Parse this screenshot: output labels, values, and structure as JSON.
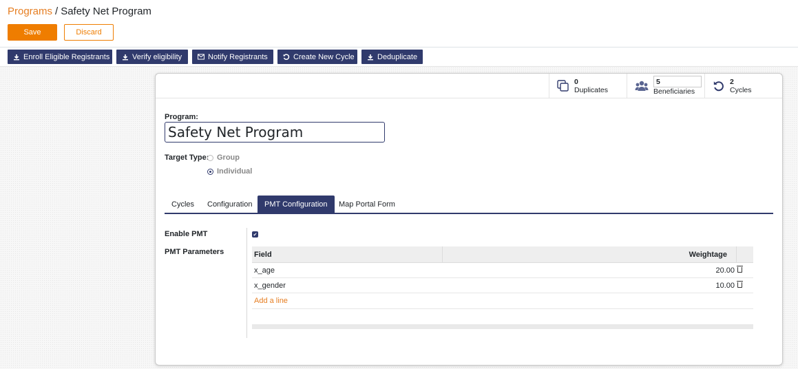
{
  "breadcrumb": {
    "parent": "Programs",
    "separator": "/",
    "current": "Safety Net Program"
  },
  "actions": {
    "save": "Save",
    "discard": "Discard"
  },
  "statusbar": {
    "buttons": [
      {
        "label": "Enroll Eligible Registrants",
        "icon": "download-icon"
      },
      {
        "label": "Verify eligibility",
        "icon": "download-icon"
      },
      {
        "label": "Notify Registrants",
        "icon": "envelope-icon"
      },
      {
        "label": "Create New Cycle",
        "icon": "refresh-icon"
      },
      {
        "label": "Deduplicate",
        "icon": "download-icon"
      }
    ]
  },
  "stats": {
    "duplicates": {
      "value": "0",
      "label": "Duplicates",
      "icon": "copy-icon"
    },
    "beneficiaries": {
      "value": "5",
      "label": "Beneficiaries",
      "icon": "users-icon"
    },
    "cycles": {
      "value": "2",
      "label": "Cycles",
      "icon": "undo-icon"
    }
  },
  "form": {
    "program_label": "Program:",
    "program_name": "Safety Net Program",
    "target_type_label": "Target Type:",
    "target_options": [
      {
        "label": "Group",
        "checked": false
      },
      {
        "label": "Individual",
        "checked": true
      }
    ]
  },
  "tabs": [
    {
      "label": "Cycles",
      "active": false
    },
    {
      "label": "Configuration",
      "active": false
    },
    {
      "label": "PMT Configuration",
      "active": true
    },
    {
      "label": "Map Portal Form",
      "active": false
    }
  ],
  "pmt": {
    "enable_label": "Enable PMT",
    "enabled": true,
    "params_label": "PMT Parameters",
    "columns": {
      "field": "Field",
      "weightage": "Weightage"
    },
    "rows": [
      {
        "field": "x_age",
        "weightage": "20.00"
      },
      {
        "field": "x_gender",
        "weightage": "10.00"
      }
    ],
    "add_line": "Add a line"
  },
  "colors": {
    "primary": "#303a6c",
    "accent": "#ef7d00",
    "link": "#e67e22"
  }
}
